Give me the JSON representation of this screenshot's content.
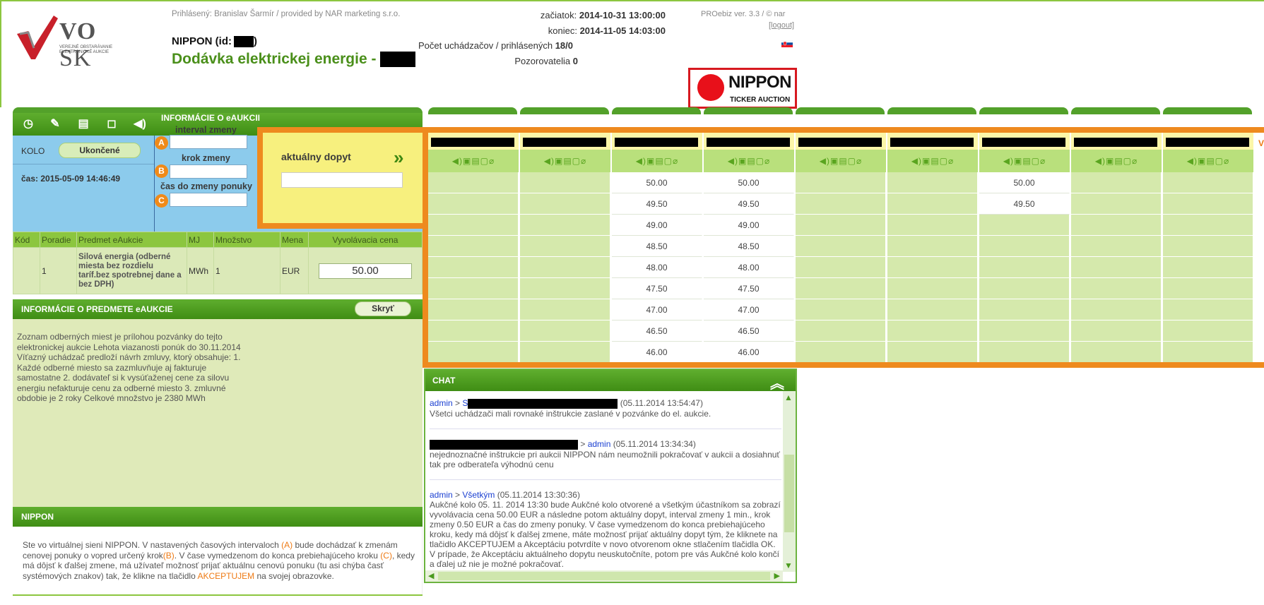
{
  "header": {
    "logged_in": "Prihlásený: Branislav Šarmír / provided by NAR marketing s.r.o.",
    "auction_id_label": "NIPPON (id:",
    "auction_id_close": ")",
    "title": "Dodávka elektrickej energie -",
    "start_label": "začiatok:",
    "start_value": "2014-10-31 13:00:00",
    "end_label": "koniec:",
    "end_value": "2014-11-05 14:03:00",
    "bidders_label": "Počet uchádzačov / prihlásených",
    "bidders_value": "18/0",
    "observers_label": "Pozorovatelia",
    "observers_value": "0",
    "version": "PROebiz ver. 3.3 / © nar",
    "logout": "[logout]"
  },
  "logo": {
    "brand": "VO",
    "brand_sk": "SK",
    "sub": "Verejné obstarávanie elektronické aukcie"
  },
  "nippon_logo": {
    "name": "NIPPON",
    "tag": "TICKER AUCTION"
  },
  "left": {
    "toolbar_title": "INFORMÁCIE O eAUKCII",
    "kolo_label": "KOLO",
    "kolo_status": "Ukončené",
    "time": "čas: 2015-05-09 14:46:49",
    "interval_label": "interval zmeny",
    "step_label": "krok zmeny",
    "time_to_change_label": "čas do zmeny ponuky",
    "markers": [
      "A",
      "B",
      "C"
    ],
    "current_offer_label": "aktuálny dopyt"
  },
  "item_table": {
    "headers": [
      "Kód",
      "Poradie",
      "Predmet eAukcie",
      "MJ",
      "Množstvo",
      "Mena",
      "Vyvolávacia cena"
    ],
    "row": {
      "kod": "",
      "poradie": "1",
      "predmet": "Silová energia (odberné miesta bez rozdielu taríf.bez spotrebnej dane a bez DPH)",
      "mj": "MWh",
      "mnozstvo": "1",
      "mena": "EUR",
      "cena": "50.00"
    }
  },
  "info": {
    "title": "INFORMÁCIE O PREDMETE eAUKCIE",
    "hide_button": "Skryť",
    "text": "Zoznam odberných miest je prílohou pozvánky do tejto elektronickej aukcie Lehota viazanosti ponúk do 30.11.2014 Víťazný uchádzač predloží návrh zmluvy, ktorý obsahuje: 1. Každé odberné miesto sa zazmluvňuje aj fakturuje samostatne 2. dodávateľ si k vysúťaženej cene za silovu energiu nefakturuje cenu za odberné miesto 3. zmluvné obdobie je 2 roky Celkové množstvo je 2380 MWh"
  },
  "nippon": {
    "title": "NIPPON",
    "t1": "Ste vo virtuálnej sieni NIPPON. V nastavených časových intervaloch ",
    "a": "(A)",
    "t2": " bude dochádzať k zmenám cenovej ponuky o vopred určený krok",
    "b": "(B)",
    "t3": ". V čase vymedzenom do konca prebiehajúceho kroku ",
    "c": "(C)",
    "t4": ", kedy má dôjsť k ďalšej zmene, má užívateľ možnosť prijať aktuálnu cenovú ponuku (tu asi chýba časť systémových znakov) tak, že klikne na tlačidlo ",
    "accept": "AKCEPTUJEM",
    "t5": " na svojej obrazovke."
  },
  "grid": {
    "icon_row": "◀)▣▤▢⌀",
    "partial_header": "Vý",
    "columns": [
      {
        "values": []
      },
      {
        "values": []
      },
      {
        "values": [
          "50.00",
          "49.50",
          "49.00",
          "48.50",
          "48.00",
          "47.50",
          "47.00",
          "46.50",
          "46.00"
        ]
      },
      {
        "values": [
          "50.00",
          "49.50",
          "49.00",
          "48.50",
          "48.00",
          "47.50",
          "47.00",
          "46.50",
          "46.00"
        ]
      },
      {
        "values": []
      },
      {
        "values": []
      },
      {
        "values": [
          "50.00",
          "49.50"
        ]
      },
      {
        "values": []
      },
      {
        "values": []
      }
    ]
  },
  "chat": {
    "title": "CHAT",
    "messages": [
      {
        "from": "admin",
        "sep": " > ",
        "to": "S",
        "time": "(05.11.2014 13:54:47)",
        "text": "Všetci uchádzači mali rovnaké inštrukcie zaslané v pozvánke do el. aukcie."
      },
      {
        "from": "",
        "sep": " > ",
        "to": "admin",
        "time": "(05.11.2014 13:34:34)",
        "text": "nejednoznačné inštrukcie pri aukcii NIPPON nám neumožnili pokračovať v aukcii a dosiahnuť tak pre odberateľa výhodnú cenu"
      },
      {
        "from": "admin",
        "sep": " > ",
        "to": "Všetkým",
        "time": "(05.11.2014 13:30:36)",
        "text": "Aukčné kolo 05. 11. 2014 13:30 bude Aukčné kolo otvorené a všetkým účastníkom sa zobrazí vyvolávacia cena 50.00 EUR a následne potom aktuálny dopyt, interval zmeny 1 min., krok zmeny 0.50 EUR a čas do zmeny ponuky. V čase vymedzenom do konca prebiehajúceho kroku, kedy má dôjsť k ďalšej zmene, máte možnosť prijať aktuálny dopyt tým, že kliknete na tlačidlo AKCEPTUJEM a Akceptáciu potvrdíte v novo otvorenom okne stlačením tlačidla OK. V prípade, že Akceptáciu aktuálneho dopytu neuskutočníte, potom pre vás Aukčné kolo končí a ďalej už nie je možné pokračovať."
      }
    ]
  },
  "colors": {
    "green": "#4a9a1e",
    "orange": "#ee8a1e",
    "yellow": "#f7f07e",
    "blue": "#8ccbec"
  }
}
